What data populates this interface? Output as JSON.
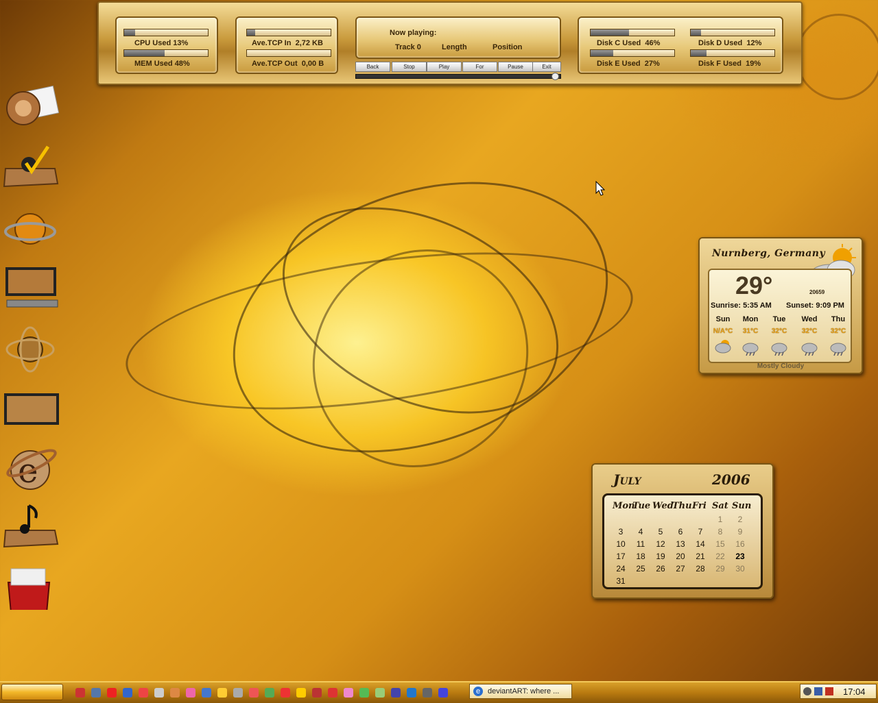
{
  "sysmon": {
    "cpu_label": "CPU Used",
    "cpu_pct": 13,
    "cpu_text": "13%",
    "mem_label": "MEM Used",
    "mem_pct": 48,
    "mem_text": "48%",
    "tcp_in_label": "Ave.TCP In",
    "tcp_in_value": "2,72 KB",
    "tcp_out_label": "Ave.TCP Out",
    "tcp_out_value": "0,00 B"
  },
  "player": {
    "now_playing": "Now playing:",
    "track": "Track 0",
    "length": "Length",
    "position": "Position",
    "buttons": [
      "Back",
      "Stop",
      "Play",
      "For",
      "Pause",
      "Exit"
    ]
  },
  "disks": [
    {
      "label": "Disk C Used",
      "pct": 46,
      "text": "46%"
    },
    {
      "label": "Disk D Used",
      "pct": 12,
      "text": "12%"
    },
    {
      "label": "Disk E Used",
      "pct": 27,
      "text": "27%"
    },
    {
      "label": "Disk F Used",
      "pct": 19,
      "text": "19%"
    }
  ],
  "desktop_icons": [
    "mail-icon",
    "checkmark-tray-icon",
    "globe-ring-icon",
    "monitor-icon",
    "atom-globe-icon",
    "monitor-small-icon",
    "internet-explorer-icon",
    "music-note-tray-icon",
    "recycle-bin-icon"
  ],
  "weather": {
    "city": "Nurnberg, Germany",
    "temp": "29°",
    "code": "20659",
    "sunrise": "Sunrise: 5:35 AM",
    "sunset": "Sunset: 9:09 PM",
    "days": [
      "Sun",
      "Mon",
      "Tue",
      "Wed",
      "Thu"
    ],
    "temps": [
      "N/A°C",
      "31°C",
      "32°C",
      "32°C",
      "32°C"
    ],
    "condition": "Mostly Cloudy"
  },
  "calendar": {
    "month": "July",
    "year": "2006",
    "weekdays": [
      "Mon",
      "Tue",
      "Wed",
      "Thu",
      "Fri",
      "Sat",
      "Sun"
    ],
    "rows": [
      [
        "",
        "",
        "",
        "",
        "",
        "1",
        "2"
      ],
      [
        "3",
        "4",
        "5",
        "6",
        "7",
        "8",
        "9"
      ],
      [
        "10",
        "11",
        "12",
        "13",
        "14",
        "15",
        "16"
      ],
      [
        "17",
        "18",
        "19",
        "20",
        "21",
        "22",
        "23"
      ],
      [
        "24",
        "25",
        "26",
        "27",
        "28",
        "29",
        "30"
      ],
      [
        "31",
        "",
        "",
        "",
        "",
        "",
        ""
      ]
    ],
    "today": "23"
  },
  "taskbar": {
    "task_label": "deviantART: where ...",
    "clock": "17:04",
    "colors": {
      "accent": "#c8860f",
      "dark": "#3a2608"
    }
  }
}
